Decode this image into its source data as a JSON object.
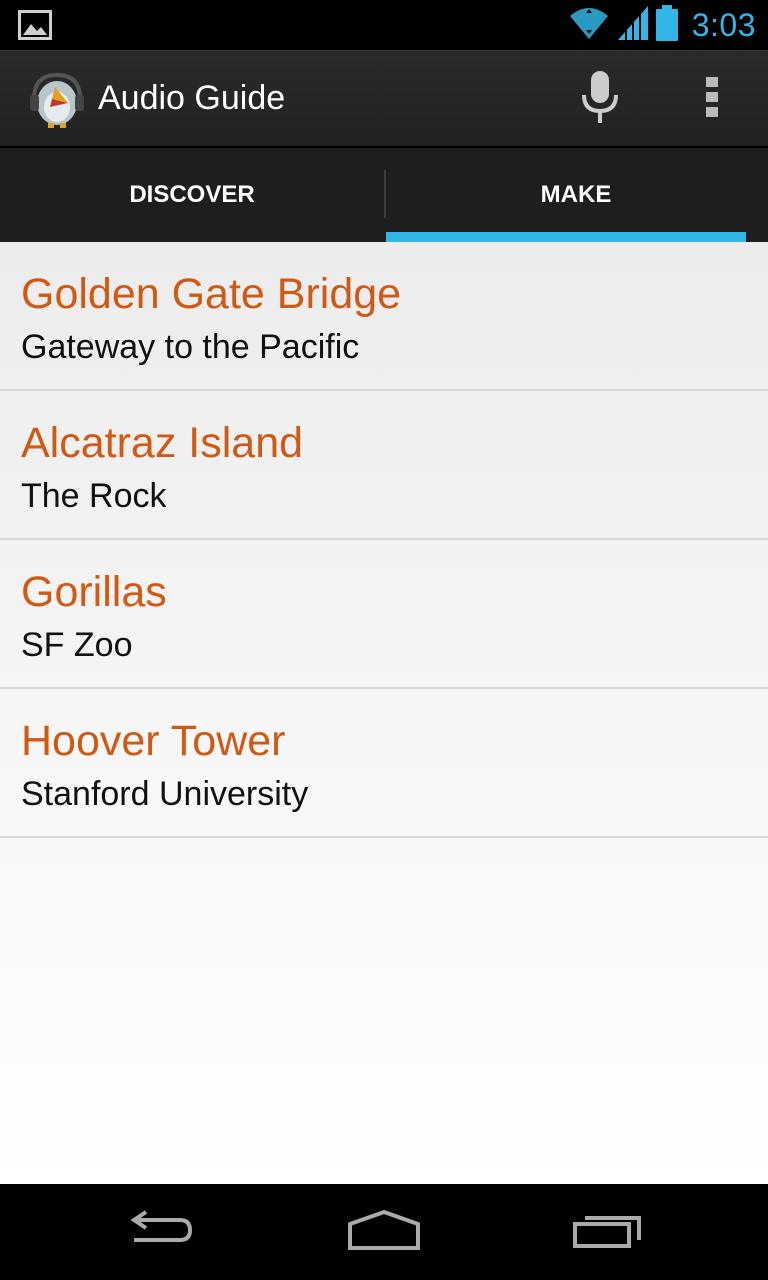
{
  "status_bar": {
    "time": "3:03",
    "icons": [
      "image-notification-icon",
      "wifi-icon",
      "signal-icon",
      "battery-icon"
    ],
    "accent_color": "#33b5e5"
  },
  "action_bar": {
    "title": "Audio Guide",
    "icons": [
      "app-logo-icon",
      "microphone-icon",
      "overflow-menu-icon"
    ]
  },
  "tabs": [
    {
      "label": "DISCOVER",
      "selected": false
    },
    {
      "label": "MAKE",
      "selected": true
    }
  ],
  "items": [
    {
      "title": "Golden Gate Bridge",
      "subtitle": "Gateway to the Pacific"
    },
    {
      "title": "Alcatraz Island",
      "subtitle": "The Rock"
    },
    {
      "title": "Gorillas",
      "subtitle": "SF Zoo"
    },
    {
      "title": "Hoover Tower",
      "subtitle": "Stanford University"
    }
  ],
  "colors": {
    "title_orange": "#d05a14",
    "tab_indicator": "#33b5e5"
  },
  "nav_bar": {
    "icons": [
      "back-icon",
      "home-icon",
      "recent-apps-icon"
    ]
  }
}
